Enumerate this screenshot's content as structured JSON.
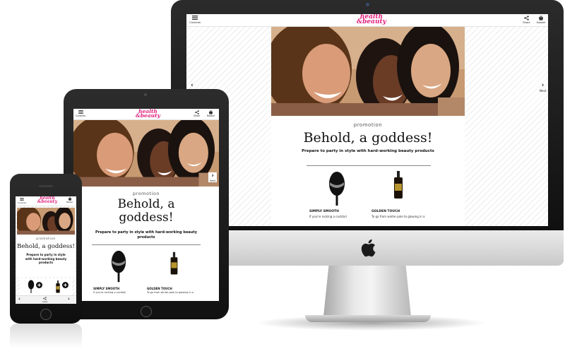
{
  "app": {
    "logo_line1": "health",
    "logo_line2": "&beauty",
    "contents_label": "Contents",
    "share_label": "Share",
    "basket_label": "Basket",
    "next_label": "Next"
  },
  "article": {
    "section": "promotion",
    "headline": "Behold, a goddess!",
    "headline_line1": "Behold, a",
    "headline_line2": "goddess!",
    "subhead": "Prepare to party in style with hard-working beauty products",
    "subhead_line1": "Prepare to party in style",
    "subhead_line2": "with hard-working beauty",
    "subhead_line3": "products"
  },
  "products": [
    {
      "name": "SIMPLY SMOOTH",
      "desc": "If you're rocking a cocktail"
    },
    {
      "name": "GOLDEN TOUCH",
      "desc": "To go from winter-pale to glowing in a"
    }
  ],
  "colors": {
    "brand": "#e0207d",
    "background": "#ffffff",
    "device_black": "#111111"
  },
  "icons": [
    "menu-icon",
    "share-icon",
    "basket-icon",
    "chevron-left-icon",
    "chevron-right-icon",
    "apple-logo-icon",
    "plus-icon"
  ]
}
